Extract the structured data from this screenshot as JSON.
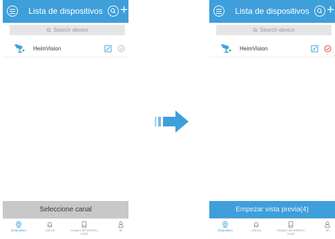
{
  "screens": [
    {
      "header": {
        "title": "Lista de dispositivos"
      },
      "search": {
        "placeholder": "Search device"
      },
      "devices": [
        {
          "name": "HeimVision",
          "selected": false
        }
      ],
      "bottom_button": {
        "label": "Seleccione canal",
        "enabled": false
      },
      "tabs": [
        {
          "label": "Dispositivo",
          "icon": "camera-icon",
          "active": true
        },
        {
          "label": "Alarma",
          "icon": "bell-icon",
          "active": false
        },
        {
          "label": "Imagen del teléfono móvil",
          "icon": "phone-icon",
          "active": false
        },
        {
          "label": "Mi",
          "icon": "person-icon",
          "active": false
        }
      ]
    },
    {
      "header": {
        "title": "Lista de dispositivos"
      },
      "search": {
        "placeholder": "Search device"
      },
      "devices": [
        {
          "name": "HeimVision",
          "selected": true
        }
      ],
      "bottom_button": {
        "label": "Empezar vista previa(4)",
        "enabled": true
      },
      "tabs": [
        {
          "label": "Dispositivo",
          "icon": "camera-icon",
          "active": true
        },
        {
          "label": "Alarma",
          "icon": "bell-icon",
          "active": false
        },
        {
          "label": "Imagen del teléfono móvil",
          "icon": "phone-icon",
          "active": false
        },
        {
          "label": "Mi",
          "icon": "person-icon",
          "active": false
        }
      ]
    }
  ],
  "colors": {
    "accent": "#3e9fdb",
    "disabled_button": "#c8c8c8",
    "selected_check": "#e53935",
    "transition_arrow": "#3e9fdb"
  }
}
